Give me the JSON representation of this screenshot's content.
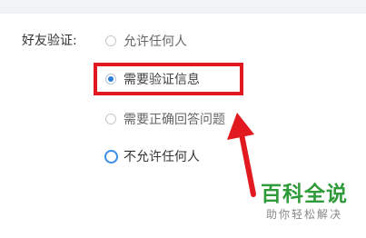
{
  "friend_verification": {
    "label": "好友验证:",
    "options": [
      {
        "text": "允许任何人",
        "state": "unselected"
      },
      {
        "text": "需要验证信息",
        "state": "selected"
      },
      {
        "text": "需要正确回答问题",
        "state": "unselected"
      },
      {
        "text": "不允许任何人",
        "state": "focus"
      }
    ]
  },
  "watermark": {
    "title": "百科全说",
    "subtitle": "助你轻松解决"
  },
  "colors": {
    "highlight": "#e2191f",
    "radio_selected": "#2b7fd8",
    "watermark_green": "#2f9b3a"
  }
}
